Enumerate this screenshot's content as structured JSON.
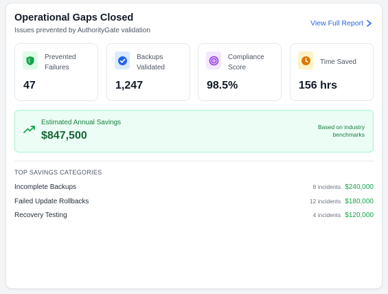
{
  "header": {
    "title": "Operational Gaps Closed",
    "subtitle": "Issues prevented by AuthorityGate validation",
    "report_link": "View Full Report"
  },
  "metrics": [
    {
      "label": "Prevented Failures",
      "value": "47",
      "icon": "shield-icon",
      "color": "#16a34a",
      "bg": "#dcfce7"
    },
    {
      "label": "Backups Validated",
      "value": "1,247",
      "icon": "check-circle-icon",
      "color": "#2563eb",
      "bg": "#dbeafe"
    },
    {
      "label": "Compliance Score",
      "value": "98.5%",
      "icon": "target-icon",
      "color": "#9333ea",
      "bg": "#f3e8ff"
    },
    {
      "label": "Time Saved",
      "value": "156 hrs",
      "icon": "clock-icon",
      "color": "#d97706",
      "bg": "#fef3c7"
    }
  ],
  "savings": {
    "label": "Estimated Annual Savings",
    "value": "$847,500",
    "note": "Based on industry benchmarks"
  },
  "categories": {
    "title": "TOP SAVINGS CATEGORIES",
    "items": [
      {
        "name": "Incomplete Backups",
        "incidents": "8 incidents",
        "amount": "$240,000"
      },
      {
        "name": "Failed Update Rollbacks",
        "incidents": "12 incidents",
        "amount": "$180,000"
      },
      {
        "name": "Recovery Testing",
        "incidents": "4 incidents",
        "amount": "$120,000"
      }
    ]
  }
}
